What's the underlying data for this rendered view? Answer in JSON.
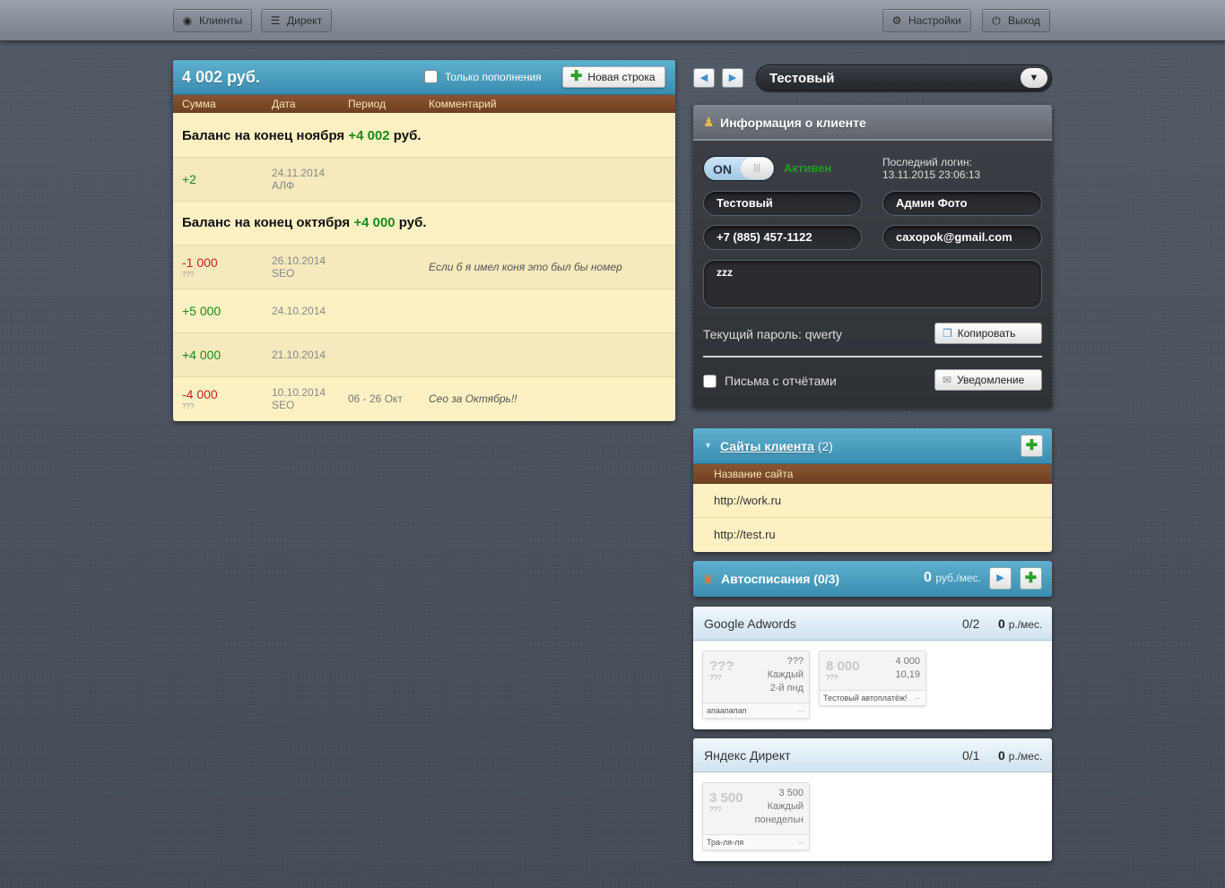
{
  "topbar": {
    "clients": "Клиенты",
    "direct": "Директ",
    "settings": "Настройки",
    "logout": "Выход"
  },
  "transactions": {
    "total": "4 002 руб.",
    "only_deposits_label": "Только пополнения",
    "new_row_label": "Новая строка",
    "columns": [
      "Сумма",
      "Дата",
      "Период",
      "Комментарий"
    ],
    "balance_nov": {
      "prefix": "Баланс на конец ноября ",
      "value": "+4 002",
      "suffix": " руб."
    },
    "balance_oct": {
      "prefix": "Баланс на конец октября ",
      "value": "+4 000",
      "suffix": " руб."
    },
    "rows": [
      {
        "amount": "+2",
        "sub": "",
        "date": "24.11.2014",
        "tag": "АЛФ",
        "period": "",
        "comment": ""
      },
      {
        "amount": "-1 000",
        "sub": "???",
        "date": "26.10.2014",
        "tag": "SEO",
        "period": "",
        "comment": "Если б я имел коня это был бы номер"
      },
      {
        "amount": "+5 000",
        "sub": "",
        "date": "24.10.2014",
        "tag": "",
        "period": "",
        "comment": ""
      },
      {
        "amount": "+4 000",
        "sub": "",
        "date": "21.10.2014",
        "tag": "",
        "period": "",
        "comment": ""
      },
      {
        "amount": "-4 000",
        "sub": "???",
        "date": "10.10.2014",
        "tag": "SEO",
        "period": "06 - 26 Окт",
        "comment": "Сео за Октябрь!!"
      }
    ]
  },
  "client_selector": {
    "prev_icon": "triangle-left-icon",
    "next_icon": "triangle-right-icon",
    "value": "Тестовый",
    "arrow": "▼"
  },
  "client_info": {
    "title": "Информация о клиенте",
    "toggle": "ON",
    "toggle_knob": "|||",
    "status": "Активен",
    "last_login_label": "Последний логин:",
    "last_login_value": "13.11.2015 23:06:13",
    "name": "Тестовый",
    "manager": "Админ Фото",
    "phone": "+7 (885) 457-1122",
    "email": "caxopok@gmail.com",
    "note": "zzz",
    "password_text": "Текущий пароль: qwerty",
    "copy_label": "Копировать",
    "reports_label": "Письма с отчётами",
    "notify_label": "Уведомление"
  },
  "sites": {
    "title": "Сайты клиента",
    "count": "(2)",
    "column": "Название сайта",
    "items": [
      "http://work.ru",
      "http://test.ru"
    ]
  },
  "autopay": {
    "title": "Автосписания (0/3)",
    "sum_value": "0",
    "sum_unit": "руб./мес.",
    "services": [
      {
        "name": "Google Adwords",
        "count": "0/2",
        "sum_value": "0",
        "sum_unit": "р./мес.",
        "cards": [
          {
            "big": "???",
            "q": "???",
            "r1": "???",
            "r2": "Каждый",
            "r3": "2-й пнд",
            "foot": "апаапапап"
          },
          {
            "big": "8 000",
            "q": "???",
            "r1": "4 000",
            "r2": "10,19",
            "r3": "",
            "foot": "Тестовый автоплатёж!"
          }
        ]
      },
      {
        "name": "Яндекс Директ",
        "count": "0/1",
        "sum_value": "0",
        "sum_unit": "р./мес.",
        "cards": [
          {
            "big": "3 500",
            "q": "???",
            "r1": "3 500",
            "r2": "Каждый",
            "r3": "понедельн",
            "foot": "Тра-ля-ля"
          }
        ]
      }
    ],
    "card_more": "..."
  },
  "colors": {
    "positive": "#1c8a1c",
    "negative": "#cc2222",
    "accent_blue": "#3a8db0",
    "header_brown": "#6e3f22",
    "panel_cream": "#fdf1c4"
  }
}
